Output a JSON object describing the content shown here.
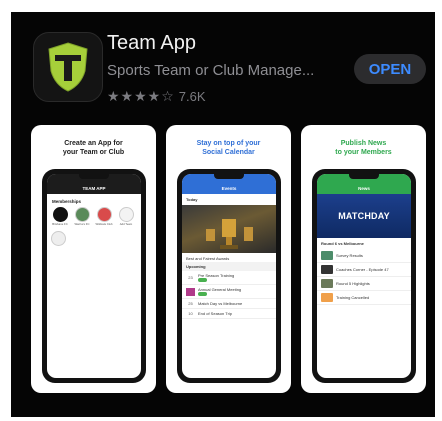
{
  "app": {
    "title": "Team App",
    "subtitle": "Sports Team or Club Manage...",
    "stars": "★★★★☆",
    "rating_count": "7.6K",
    "open_label": "OPEN",
    "icon_letter": "T"
  },
  "colors": {
    "open_text": "#3d8bff",
    "shield_green": "#a6cf3a"
  },
  "screenshots": [
    {
      "caption_line1": "Create an App for",
      "caption_line2": "your Team or Club",
      "caption_color": "#222222",
      "screen_title": "TEAM APP",
      "section": "Memberships",
      "items": [
        "Brisbane FC",
        "Warriors FC",
        "Wildcats Club",
        "Add Team"
      ]
    },
    {
      "caption_line1": "Stay on top of your",
      "caption_line2": "Social Calendar",
      "caption_color": "#2f6fd6",
      "screen_title": "Events",
      "today": "Today",
      "hero_caption": "Best and Fairest Awards",
      "upcoming": "Upcoming",
      "events": [
        {
          "date": "23",
          "title": "Pre Season Training"
        },
        {
          "date": "",
          "title": "Annual General Meeting"
        },
        {
          "date": "25",
          "title": "Match Day vs Melbourne"
        },
        {
          "date": "10",
          "title": "End of Season Trip"
        }
      ]
    },
    {
      "caption_line1": "Publish News",
      "caption_line2": "to your Members",
      "caption_color": "#2fa84f",
      "screen_title": "News",
      "banner": "MATCHDAY",
      "lead": "Round 6 vs Melbourne",
      "news": [
        "Survey Results",
        "Coaches Corner - Episode 47",
        "Round 5 Highlights",
        "Training Cancelled"
      ]
    }
  ]
}
